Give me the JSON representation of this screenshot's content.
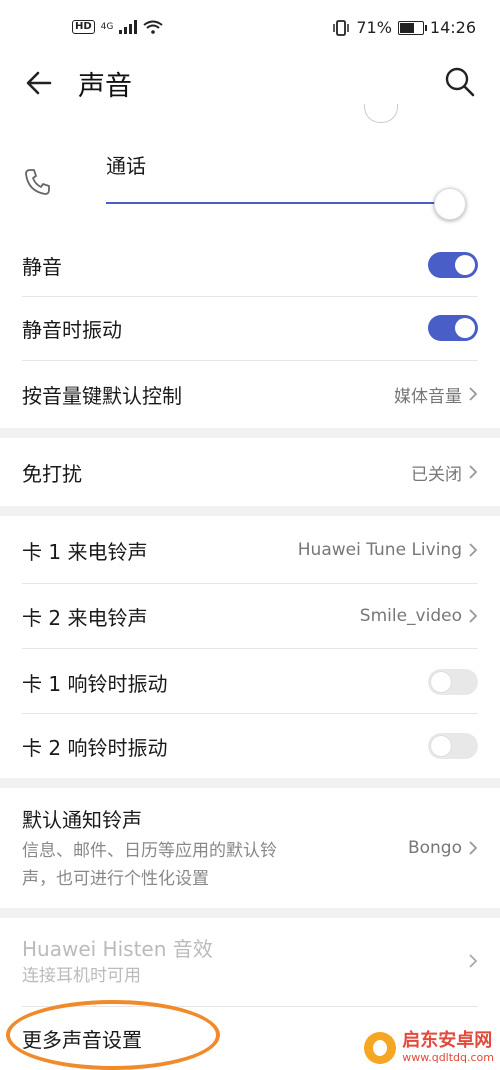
{
  "status_bar": {
    "network": "4G",
    "battery_text": "71%",
    "battery_level": 0.71,
    "time": "14:26",
    "hd": "HD"
  },
  "header": {
    "title": "声音"
  },
  "volume": {
    "call_label": "通话",
    "call_level": 1.0
  },
  "rows": {
    "mute": {
      "label": "静音",
      "on": true
    },
    "mute_vibrate": {
      "label": "静音时振动",
      "on": true
    },
    "volume_key": {
      "label": "按音量键默认控制",
      "value": "媒体音量"
    },
    "dnd": {
      "label": "免打扰",
      "value": "已关闭"
    },
    "sim1_ringtone": {
      "label": "卡 1 来电铃声",
      "value": "Huawei Tune Living"
    },
    "sim2_ringtone": {
      "label": "卡 2 来电铃声",
      "value": "Smile_video"
    },
    "sim1_vibrate": {
      "label": "卡 1 响铃时振动",
      "on": false
    },
    "sim2_vibrate": {
      "label": "卡 2 响铃时振动",
      "on": false
    },
    "notification": {
      "label": "默认通知铃声",
      "desc_line1": "信息、邮件、日历等应用的默认铃",
      "desc_line2": "声，也可进行个性化设置",
      "value": "Bongo"
    },
    "histen": {
      "label": "Huawei Histen 音效",
      "desc": "连接耳机时可用"
    },
    "more": {
      "label": "更多声音设置"
    }
  },
  "watermark": {
    "name": "启东安卓网",
    "url": "www.qdltdq.com"
  },
  "colors": {
    "accent": "#4a5ec8",
    "highlight_circle": "#f08a2b"
  }
}
